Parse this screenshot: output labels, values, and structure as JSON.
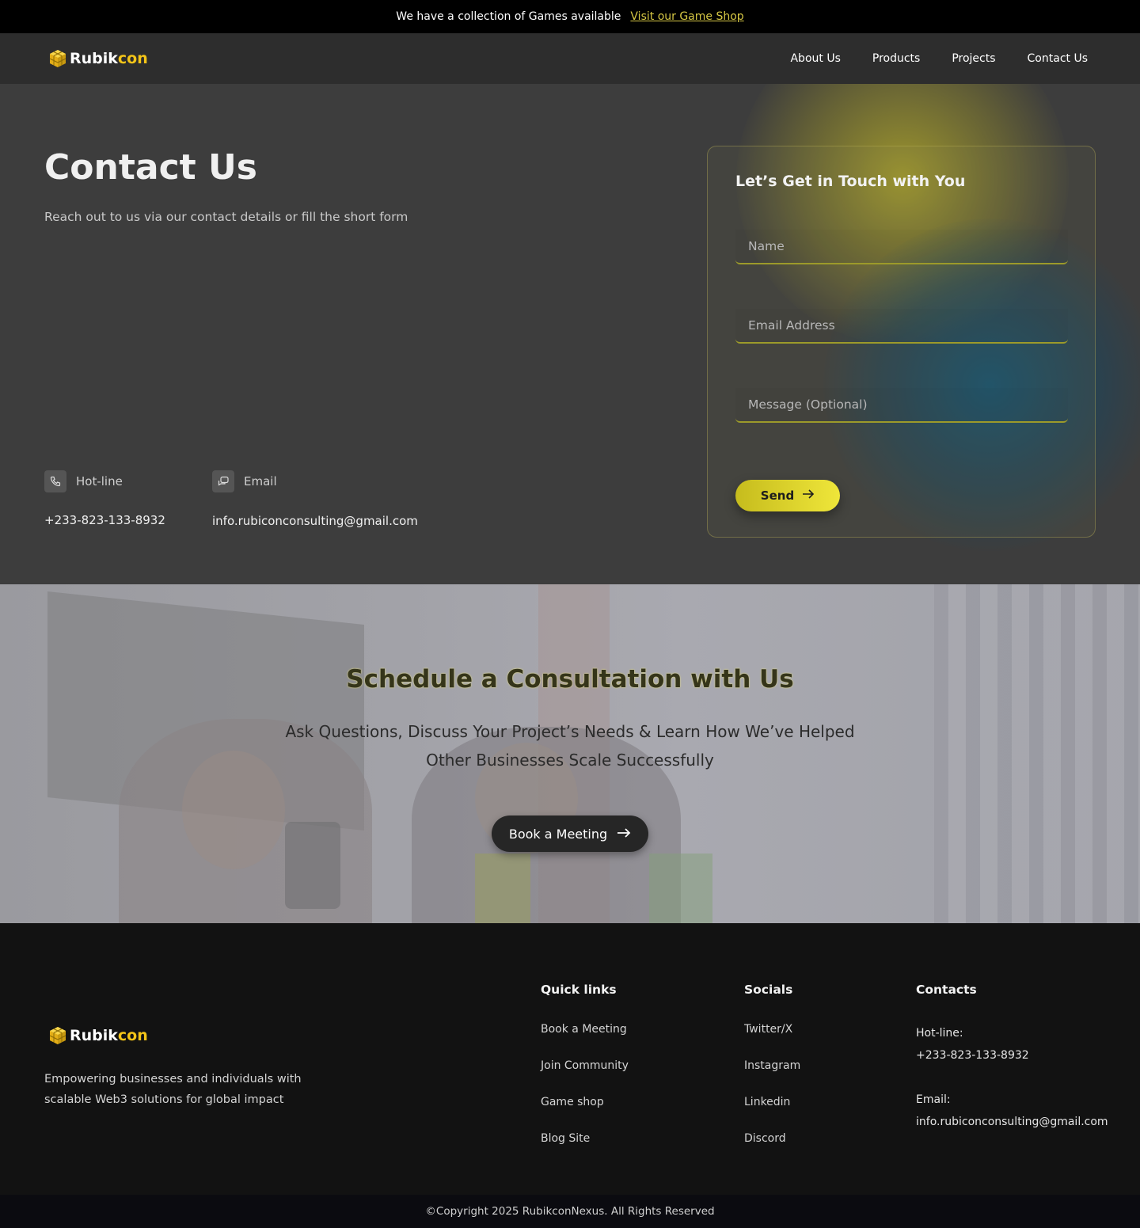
{
  "announcement": {
    "text": "We have a collection of Games available",
    "link": "Visit our Game Shop"
  },
  "brand": {
    "part1": "Rubik",
    "part2": "con",
    "accent_color": "#f3c418"
  },
  "nav": {
    "items": [
      {
        "label": "About Us"
      },
      {
        "label": "Products"
      },
      {
        "label": "Projects"
      },
      {
        "label": "Contact Us"
      }
    ]
  },
  "hero": {
    "title": "Contact Us",
    "subtitle": "Reach out to us via our contact details or fill the short form",
    "hotline": {
      "label": "Hot-line",
      "value": "+233-823-133-8932",
      "icon": "phone-icon"
    },
    "email": {
      "label": "Email",
      "value": "info.rubiconconsulting@gmail.com",
      "icon": "chat-icon"
    }
  },
  "form": {
    "title": "Let’s Get in Touch with You",
    "name_placeholder": "Name",
    "email_placeholder": "Email Address",
    "message_placeholder": "Message (Optional)",
    "send_label": "Send",
    "accent_color": "#e6dc32"
  },
  "consultation": {
    "title": "Schedule a Consultation with Us",
    "text": "Ask Questions, Discuss Your Project’s Needs & Learn How We’ve Helped Other Businesses Scale Successfully",
    "button": "Book a Meeting"
  },
  "footer": {
    "tagline": "Empowering businesses and individuals with scalable Web3 solutions for global impact",
    "quick_links": {
      "title": "Quick links",
      "items": [
        "Book a Meeting",
        "Join Community",
        "Game shop",
        "Blog Site"
      ]
    },
    "socials": {
      "title": "Socials",
      "items": [
        "Twitter/X",
        "Instagram",
        "Linkedin",
        "Discord"
      ]
    },
    "contacts": {
      "title": "Contacts",
      "hotline_label": "Hot-line:",
      "hotline": "+233-823-133-8932",
      "email_label": "Email:",
      "email": "info.rubiconconsulting@gmail.com"
    },
    "copyright": "©Copyright 2025 RubikconNexus. All Rights Reserved"
  }
}
